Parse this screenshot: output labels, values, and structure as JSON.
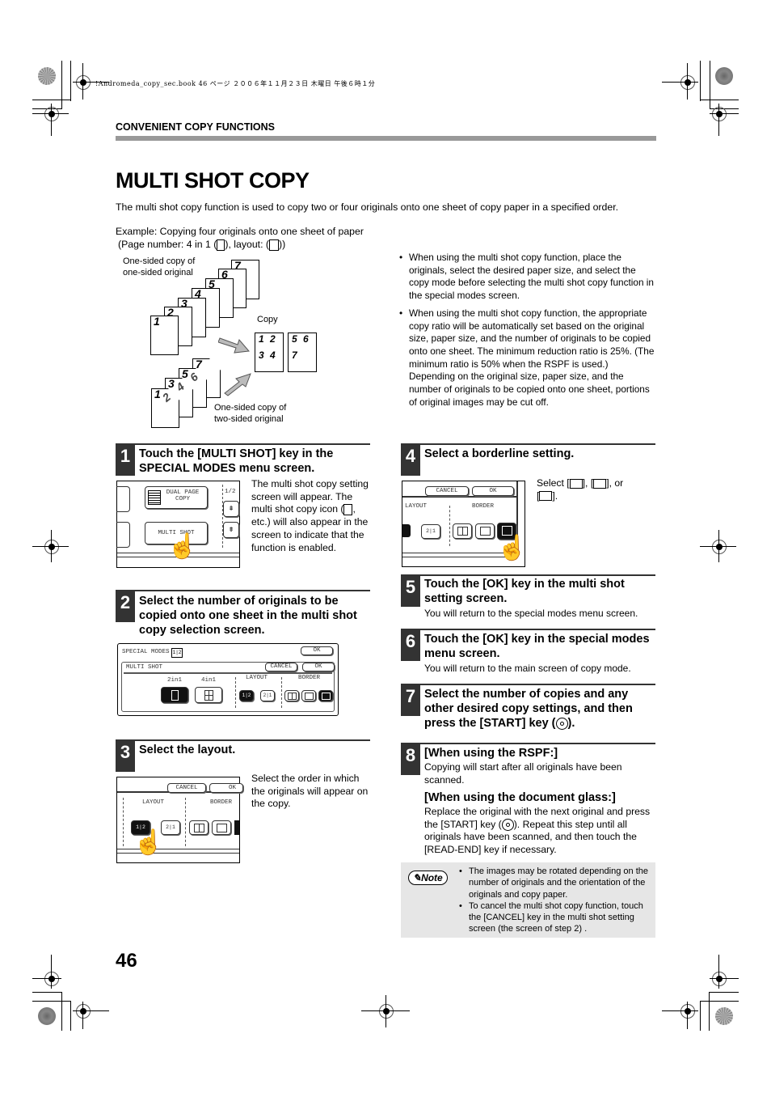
{
  "print_header": "!Andromeda_copy_sec.book  46 ページ  ２００６年１１月２３日  木曜日  午後６時１分",
  "section_label": "CONVENIENT COPY FUNCTIONS",
  "page_title": "MULTI SHOT COPY",
  "intro": "The multi shot copy function is used to copy two or four originals onto one sheet of copy paper in a specified order.",
  "example": {
    "line1": "Example: Copying four originals onto one sheet of paper",
    "line2_prefix": "(Page number: 4 in 1 (",
    "line2_middle": "), layout: (",
    "line2_suffix": "))",
    "label_one_sided": [
      "One-sided copy of",
      "one-sided original"
    ],
    "label_two_sided": [
      "One-sided copy of",
      "two-sided original"
    ],
    "label_copy": "Copy",
    "originals": [
      "1",
      "2",
      "3",
      "4",
      "5",
      "6",
      "7"
    ],
    "copy_sheet_1": [
      "1",
      "2",
      "3",
      "4"
    ],
    "copy_sheet_2": [
      "5",
      "6",
      "7"
    ],
    "two_sided_pages": [
      "1",
      "2",
      "3",
      "4",
      "5",
      "6",
      "7"
    ]
  },
  "notes_right": [
    "When using the multi shot copy function, place the originals, select the desired paper size, and select the copy mode before selecting the multi shot copy function in the special modes screen.",
    "When using the multi shot copy function, the appropriate copy ratio will be automatically set based on the original size, paper size, and the number of originals to be copied onto one sheet. The minimum reduction ratio is 25%. (The minimum ratio is 50% when the RSPF is used.) Depending on the original size, paper size, and the number of originals to be copied onto one sheet, portions of original images may be cut off."
  ],
  "steps": [
    {
      "num": "1",
      "title": "Touch the [MULTI SHOT] key in the SPECIAL MODES menu screen.",
      "desc_parts": [
        "The multi shot copy setting screen will appear. The multi shot copy icon (",
        ", etc.) will also appear in the screen to indicate that the function is enabled."
      ],
      "screen": {
        "dual_page_copy": "DUAL PAGE\nCOPY",
        "dual_line1": "DUAL PAGE",
        "dual_line2": "COPY",
        "multi_shot": "MULTI SHOT",
        "page": "1/2"
      }
    },
    {
      "num": "2",
      "title": "Select the number of originals to be copied onto one sheet in the multi shot copy selection screen.",
      "screen": {
        "special_modes": "SPECIAL MODES",
        "ok_top": "OK",
        "multi_shot": "MULTI SHOT",
        "cancel": "CANCEL",
        "ok": "OK",
        "two_in_one": "2in1",
        "four_in_one": "4in1",
        "layout": "LAYOUT",
        "border": "BORDER",
        "layout_a": "1|2",
        "layout_b": "2|1"
      }
    },
    {
      "num": "3",
      "title": "Select the layout.",
      "desc": "Select the order in which the originals will appear on the copy.",
      "screen": {
        "cancel": "CANCEL",
        "ok": "OK",
        "layout": "LAYOUT",
        "border": "BORDER",
        "layout_a": "1|2",
        "layout_b": "2|1"
      }
    },
    {
      "num": "4",
      "title": "Select a borderline setting.",
      "desc_parts": [
        "Select [",
        "], [",
        "], or",
        "[",
        "]."
      ],
      "screen": {
        "cancel": "CANCEL",
        "ok": "OK",
        "layout": "LAYOUT",
        "border": "BORDER",
        "layout_b": "2|1"
      }
    },
    {
      "num": "5",
      "title": "Touch the [OK] key in the multi shot setting screen.",
      "desc": "You will return to the special modes menu screen."
    },
    {
      "num": "6",
      "title": "Touch the [OK] key in the special modes menu screen.",
      "desc": "You will return to the main screen of copy mode."
    },
    {
      "num": "7",
      "title_prefix": "Select the number of copies and any other desired copy settings, and then press the [START] key (",
      "title_suffix": ")."
    },
    {
      "num": "8",
      "sub1_title": "[When using the RSPF:]",
      "sub1_desc": "Copying will start after all originals have been scanned.",
      "sub2_title": "[When using the document glass:]",
      "sub2_desc_prefix": "Replace the original with the next original and press the [START] key (",
      "sub2_desc_suffix": "). Repeat this step until all originals have been scanned, and then touch the [READ-END] key if necessary."
    }
  ],
  "note": {
    "badge": "Note",
    "items": [
      "The images may be rotated depending on the number of originals and the orientation of the originals and copy paper.",
      "To cancel the multi shot copy function, touch the [CANCEL] key in the multi shot setting screen  (the screen of step 2) ."
    ]
  },
  "page_number": "46",
  "icons": {
    "start_key": "start-key-icon",
    "note": "pencil-note-icon",
    "hand": "hand-pointer-icon",
    "crop_mark": "registration-mark-icon"
  }
}
